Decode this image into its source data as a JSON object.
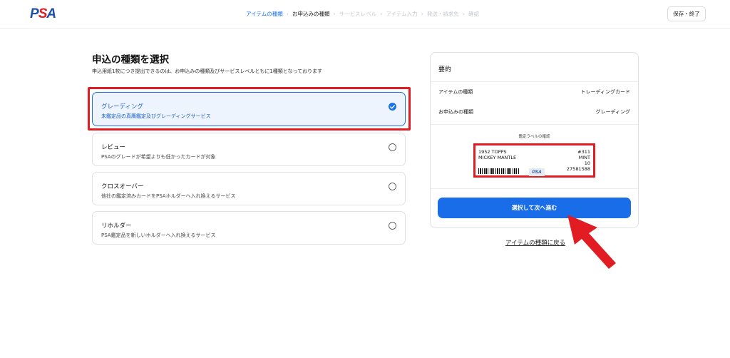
{
  "header": {
    "logo": {
      "p": "P",
      "s": "S",
      "a": "A"
    },
    "steps": [
      {
        "label": "アイテムの種類",
        "state": "active"
      },
      {
        "label": "お申込みの種類",
        "state": "current"
      },
      {
        "label": "サービスレベル",
        "state": "upcoming"
      },
      {
        "label": "アイテム入力",
        "state": "upcoming"
      },
      {
        "label": "発送・請求先",
        "state": "upcoming"
      },
      {
        "label": "確認",
        "state": "upcoming"
      }
    ],
    "step_separator": "›",
    "save_label": "保存・終了"
  },
  "main": {
    "title": "申込の種類を選択",
    "subtitle": "申込用紙1枚につき提出できるのは、お申込みの種類及びサービスレベルともに1種類となっております",
    "options": [
      {
        "title": "グレーディング",
        "desc": "未鑑定品の真贋鑑定及びグレーディングサービス",
        "selected": true
      },
      {
        "title": "レビュー",
        "desc": "PSAのグレードが希望よりも低かったカードが対象",
        "selected": false
      },
      {
        "title": "クロスオーバー",
        "desc": "他社の鑑定済みカードをPSAホルダーへ入れ換えるサービス",
        "selected": false
      },
      {
        "title": "リホルダー",
        "desc": "PSA鑑定品を新しいホルダーへ入れ換えるサービス",
        "selected": false
      }
    ]
  },
  "summary": {
    "title": "要約",
    "rows": [
      {
        "label": "アイテムの種類",
        "value": "トレーディングカード"
      },
      {
        "label": "お申込みの種類",
        "value": "グレーディング"
      }
    ],
    "label_caption": "鑑定ラベルの確認",
    "sample_label": {
      "line1": "1952 TOPPS",
      "line2": "MICKEY MANTLE",
      "number": "#311",
      "grade_text": "MINT",
      "grade": "10",
      "cert": "27581588",
      "mini_logo": "PSA"
    },
    "cta_label": "選択して次へ進む",
    "back_link": "アイテムの種類に戻る"
  },
  "colors": {
    "accent": "#1a6de8",
    "highlight": "#e21c23",
    "logo_blue": "#1b4fa8",
    "logo_red": "#e21c23"
  }
}
